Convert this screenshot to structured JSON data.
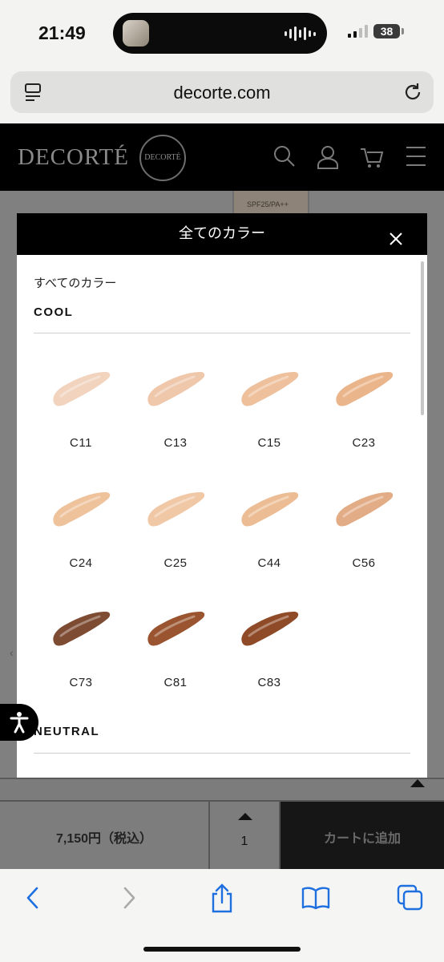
{
  "status": {
    "time": "21:49",
    "battery": "38"
  },
  "browser": {
    "url": "decorte.com"
  },
  "site": {
    "logo": "DECORTÉ",
    "seal": "DECORTÉ"
  },
  "modal": {
    "title": "全てのカラー",
    "subtitle": "すべてのカラー",
    "groups": [
      {
        "name": "COOL",
        "swatches": [
          {
            "code": "C11",
            "color": "#f1d3be"
          },
          {
            "code": "C13",
            "color": "#efc7ab"
          },
          {
            "code": "C15",
            "color": "#eec09c"
          },
          {
            "code": "C23",
            "color": "#ebb58b"
          },
          {
            "code": "C24",
            "color": "#eec29b"
          },
          {
            "code": "C25",
            "color": "#f0c8a6"
          },
          {
            "code": "C44",
            "color": "#ecbd94"
          },
          {
            "code": "C56",
            "color": "#e2ad86"
          },
          {
            "code": "C73",
            "color": "#7e4b33"
          },
          {
            "code": "C81",
            "color": "#9a5530"
          },
          {
            "code": "C83",
            "color": "#8f4a28"
          }
        ]
      },
      {
        "name": "NEUTRAL",
        "swatches": []
      }
    ]
  },
  "cart": {
    "price": "7,150円（税込）",
    "quantity": "1",
    "add_label": "カートに追加"
  }
}
